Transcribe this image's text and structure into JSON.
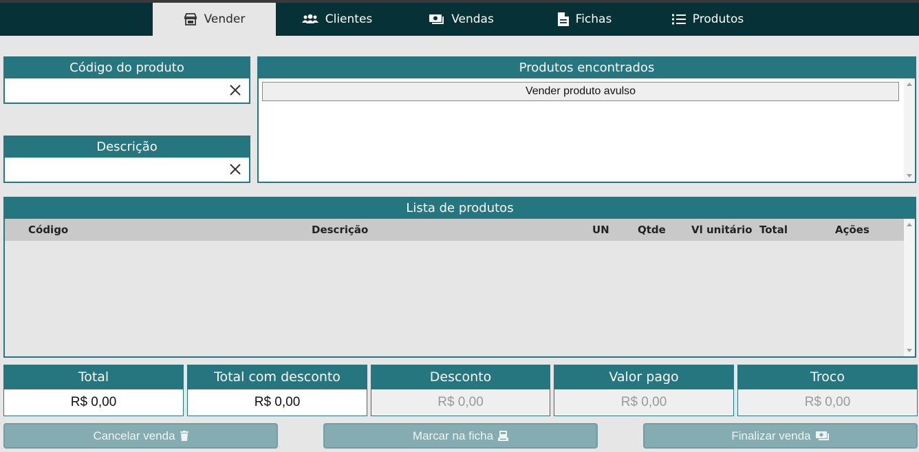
{
  "nav": {
    "tabs": [
      {
        "label": "Vender",
        "icon": "store-icon",
        "active": true
      },
      {
        "label": "Clientes",
        "icon": "users-icon",
        "active": false
      },
      {
        "label": "Vendas",
        "icon": "money-bill-icon",
        "active": false
      },
      {
        "label": "Fichas",
        "icon": "file-icon",
        "active": false
      },
      {
        "label": "Produtos",
        "icon": "list-icon",
        "active": false
      }
    ]
  },
  "codigo": {
    "title": "Código do produto",
    "value": "",
    "placeholder": ""
  },
  "descricao": {
    "title": "Descrição",
    "value": "",
    "placeholder": ""
  },
  "encontrados": {
    "title": "Produtos encontrados",
    "button_label": "Vender produto avulso"
  },
  "lista": {
    "title": "Lista de produtos",
    "columns": [
      "Código",
      "Descrição",
      "UN",
      "Qtde",
      "Vl unitário",
      "Total",
      "Ações"
    ],
    "rows": []
  },
  "totais": [
    {
      "label": "Total",
      "value": "R$ 0,00"
    },
    {
      "label": "Total com desconto",
      "value": "R$ 0,00"
    },
    {
      "label": "Desconto",
      "value": "R$ 0,00"
    },
    {
      "label": "Valor pago",
      "value": "R$ 0,00"
    },
    {
      "label": "Troco",
      "value": "R$ 0,00"
    }
  ],
  "actions": {
    "cancelar": {
      "label": "Cancelar venda",
      "icon": "trash-icon"
    },
    "marcar": {
      "label": "Marcar na ficha",
      "icon": "register-icon"
    },
    "finalizar": {
      "label": "Finalizar venda",
      "icon": "money-bill-icon"
    }
  },
  "colors": {
    "primary": "#267680",
    "header": "#063237",
    "background": "#e6e6e6",
    "disabled_button": "#85acb1"
  }
}
